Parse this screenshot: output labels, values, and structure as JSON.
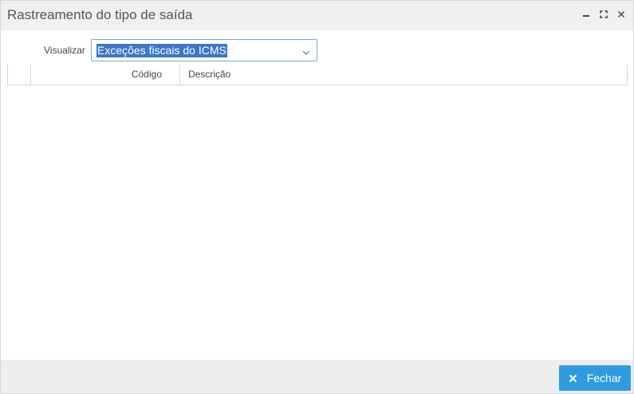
{
  "dialog": {
    "title": "Rastreamento do tipo de saída",
    "controls": [
      "minimize-icon",
      "maximize-icon",
      "close-icon"
    ]
  },
  "filter": {
    "label": "Visualizar",
    "selected": "Exceções fiscais do ICMS"
  },
  "grid": {
    "columns": [
      "",
      "Código",
      "Descrição"
    ],
    "rows": []
  },
  "footer": {
    "close_label": "Fechar",
    "close_icon": "x-icon",
    "accent": "#2e9be0"
  }
}
